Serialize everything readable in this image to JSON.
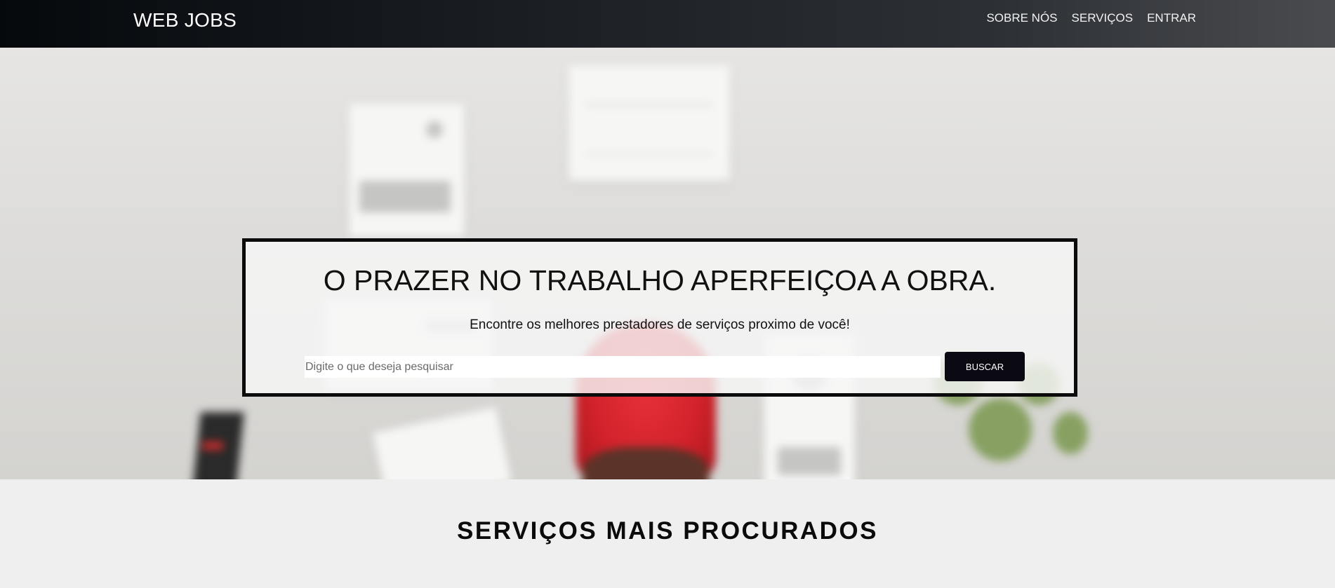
{
  "header": {
    "brand": "WEB JOBS",
    "nav": [
      {
        "label": "SOBRE NÓS"
      },
      {
        "label": "SERVIÇOS"
      },
      {
        "label": "ENTRAR"
      }
    ]
  },
  "hero": {
    "title": "O PRAZER NO TRABALHO APERFEIÇOA A OBRA.",
    "subtitle": "Encontre os melhores prestadores de serviços proximo de você!",
    "search": {
      "placeholder": "Digite o que deseja pesquisar",
      "value": "",
      "button_label": "BUSCAR"
    }
  },
  "sections": {
    "most_searched_title": "SERVIÇOS MAIS PROCURADOS"
  },
  "colors": {
    "card_border": "#0b0b0b",
    "button_bg": "#0b0a12",
    "accent_red": "#d2222b"
  }
}
